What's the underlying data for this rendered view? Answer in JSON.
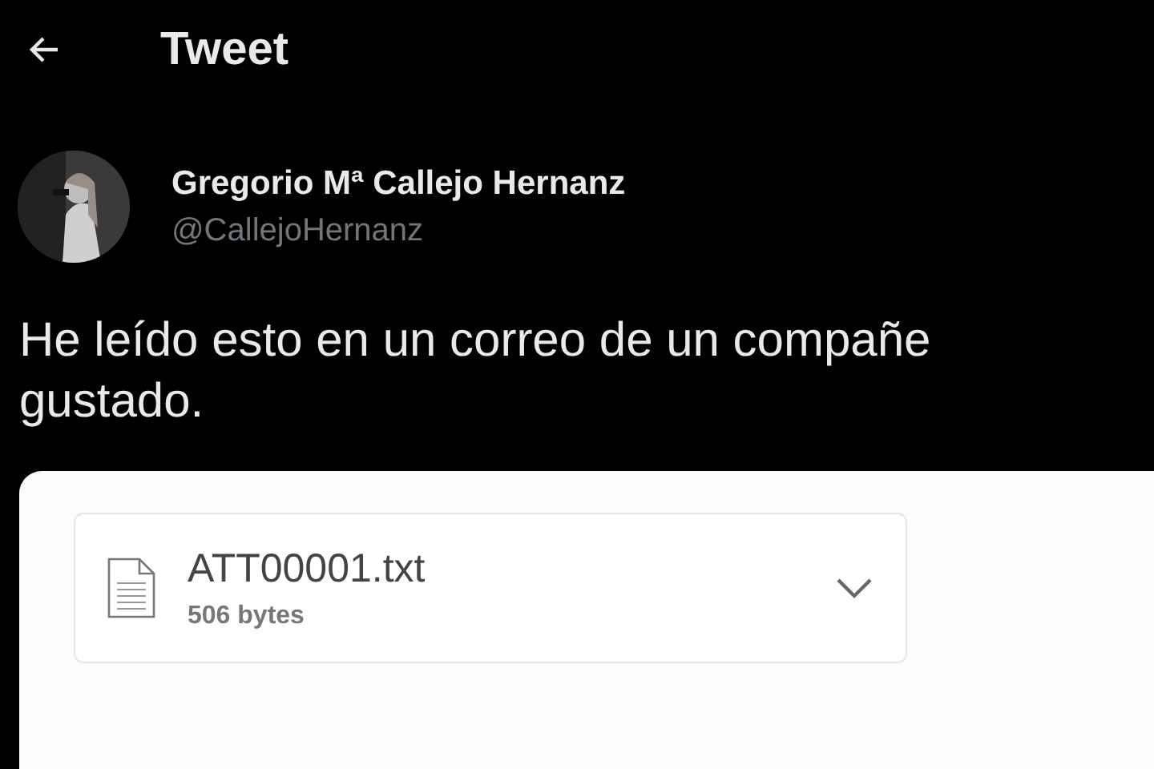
{
  "header": {
    "title": "Tweet"
  },
  "author": {
    "name": "Gregorio Mª Callejo Hernanz",
    "handle": "@CallejoHernanz"
  },
  "tweet_text": [
    "He leído esto en un correo de un compañe",
    "gustado."
  ],
  "attachment": {
    "filename": "ATT00001.txt",
    "size": "506 bytes"
  }
}
